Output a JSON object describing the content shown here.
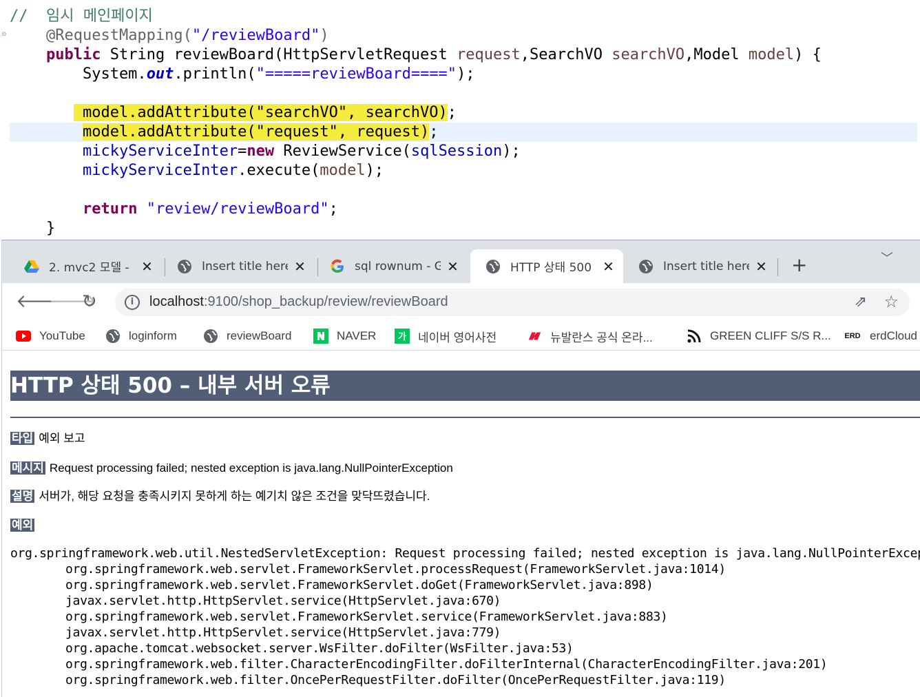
{
  "editor": {
    "lines": [
      {
        "parts": [
          {
            "t": "//  임시 메인페이지",
            "c": "cmt"
          }
        ]
      },
      {
        "parts": [
          {
            "t": "    ",
            "c": ""
          },
          {
            "t": "@RequestMapping(",
            "c": "ann"
          },
          {
            "t": "\"/reviewBoard\"",
            "c": "str"
          },
          {
            "t": ")",
            "c": "ann"
          }
        ]
      },
      {
        "parts": [
          {
            "t": "    ",
            "c": ""
          },
          {
            "t": "public",
            "c": "kw"
          },
          {
            "t": " String reviewBoard(HttpServletRequest ",
            "c": ""
          },
          {
            "t": "request",
            "c": "prm"
          },
          {
            "t": ",SearchVO ",
            "c": ""
          },
          {
            "t": "searchVO",
            "c": "prm"
          },
          {
            "t": ",Model ",
            "c": ""
          },
          {
            "t": "model",
            "c": "prm"
          },
          {
            "t": ") {",
            "c": ""
          }
        ]
      },
      {
        "parts": [
          {
            "t": "        System.",
            "c": ""
          },
          {
            "t": "out",
            "c": "sfld"
          },
          {
            "t": ".println(",
            "c": ""
          },
          {
            "t": "\"=====reviewBoard====\"",
            "c": "str"
          },
          {
            "t": ");",
            "c": ""
          }
        ]
      },
      {
        "parts": []
      },
      {
        "parts": [
          {
            "t": "       ",
            "c": ""
          },
          {
            "t": " model.addAttribute(\"searchVO\", searchVO)",
            "c": "hl"
          },
          {
            "t": ";",
            "c": ""
          }
        ]
      },
      {
        "current": true,
        "parts": [
          {
            "t": "        ",
            "c": ""
          },
          {
            "t": "model.addAttribute(\"request\", request)",
            "c": "hl"
          },
          {
            "t": ";",
            "c": ""
          }
        ]
      },
      {
        "parts": [
          {
            "t": "        ",
            "c": ""
          },
          {
            "t": "mickyServiceInter",
            "c": "fld"
          },
          {
            "t": "=",
            "c": ""
          },
          {
            "t": "new",
            "c": "kw"
          },
          {
            "t": " ReviewService(",
            "c": ""
          },
          {
            "t": "sqlSession",
            "c": "fld"
          },
          {
            "t": ");",
            "c": ""
          }
        ]
      },
      {
        "parts": [
          {
            "t": "        ",
            "c": ""
          },
          {
            "t": "mickyServiceInter",
            "c": "fld"
          },
          {
            "t": ".execute(",
            "c": ""
          },
          {
            "t": "model",
            "c": "prm"
          },
          {
            "t": ");",
            "c": ""
          }
        ]
      },
      {
        "parts": []
      },
      {
        "parts": [
          {
            "t": "        ",
            "c": ""
          },
          {
            "t": "return",
            "c": "kw"
          },
          {
            "t": " ",
            "c": ""
          },
          {
            "t": "\"review/reviewBoard\"",
            "c": "str"
          },
          {
            "t": ";",
            "c": ""
          }
        ]
      },
      {
        "parts": [
          {
            "t": "    }",
            "c": ""
          }
        ]
      }
    ]
  },
  "tabs": [
    {
      "title": "2. mvc2 모델 -",
      "icon": "google-drive-icon",
      "active": false
    },
    {
      "title": "Insert title here",
      "icon": "globe-icon",
      "active": false
    },
    {
      "title": "sql rownum - G",
      "icon": "google-icon",
      "active": false
    },
    {
      "title": "HTTP 상태 500",
      "icon": "globe-icon",
      "active": true
    },
    {
      "title": "Insert title here",
      "icon": "globe-icon",
      "active": false
    }
  ],
  "toolbar": {
    "url_host": "localhost",
    "url_rest": ":9100/shop_backup/review/reviewBoard",
    "info_icon": "info-icon"
  },
  "bookmarks": [
    {
      "label": "YouTube",
      "icon": "youtube-icon"
    },
    {
      "label": "loginform",
      "icon": "globe-icon"
    },
    {
      "label": "reviewBoard",
      "icon": "globe-icon"
    },
    {
      "label": "NAVER",
      "icon": "naver-icon"
    },
    {
      "label": "네이버 영어사전",
      "icon": "naver-dict-icon"
    },
    {
      "label": "뉴발란스 공식 온라...",
      "icon": "newbalance-icon"
    },
    {
      "label": "GREEN CLIFF S/S R...",
      "icon": "rss-icon"
    },
    {
      "label": "erdCloud",
      "icon": "erd-icon",
      "icon_text": "ERD"
    }
  ],
  "error": {
    "title": "HTTP 상태 500 – 내부 서버 오류",
    "type_label": "타입",
    "type_value": "예외 보고",
    "message_label": "메시지",
    "message_value": "Request processing failed; nested exception is java.lang.NullPointerException",
    "desc_label": "설명",
    "desc_value": "서버가, 해당 요청을 충족시키지 못하게 하는 예기치 않은 조건을 맞닥뜨렸습니다.",
    "exception_label": "예외",
    "trace": [
      "org.springframework.web.util.NestedServletException: Request processing failed; nested exception is java.lang.NullPointerException",
      "\torg.springframework.web.servlet.FrameworkServlet.processRequest(FrameworkServlet.java:1014)",
      "\torg.springframework.web.servlet.FrameworkServlet.doGet(FrameworkServlet.java:898)",
      "\tjavax.servlet.http.HttpServlet.service(HttpServlet.java:670)",
      "\torg.springframework.web.servlet.FrameworkServlet.service(FrameworkServlet.java:883)",
      "\tjavax.servlet.http.HttpServlet.service(HttpServlet.java:779)",
      "\torg.apache.tomcat.websocket.server.WsFilter.doFilter(WsFilter.java:53)",
      "\torg.springframework.web.filter.CharacterEncodingFilter.doFilterInternal(CharacterEncodingFilter.java:201)",
      "\torg.springframework.web.filter.OncePerRequestFilter.doFilter(OncePerRequestFilter.java:119)"
    ]
  }
}
